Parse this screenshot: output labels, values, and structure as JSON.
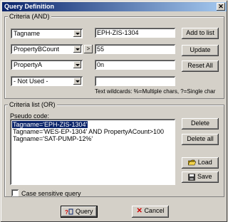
{
  "window": {
    "title": "Query Definition",
    "close_glyph": "✕"
  },
  "criteria_and": {
    "label": "Criteria (AND)",
    "rows": [
      {
        "field": "Tagname",
        "value": "EPH-ZIS-1304"
      },
      {
        "field": "PropertyBCount",
        "operator": ">",
        "value": "55"
      },
      {
        "field": "PropertyA",
        "value": "0n"
      },
      {
        "field": "- Not Used -",
        "value": ""
      }
    ],
    "buttons": {
      "add_to_list": "Add to list",
      "update": "Update",
      "reset_all": "Reset All"
    },
    "wildcard_hint": "Text wildcards: %=Multiple chars, ?=Single char"
  },
  "criteria_or": {
    "label": "Criteria list (OR)",
    "pseudo_label": "Pseudo code:",
    "items": [
      "Tagname='EPH-ZIS-1304'",
      "Tagname='WES-EP-1304' AND PropertyACount>100",
      "Tagname='SAT-PUMP-12%'"
    ],
    "selected_index": 0,
    "buttons": {
      "delete": "Delete",
      "delete_all": "Delete all",
      "load": "Load",
      "save": "Save"
    },
    "case_sensitive_label": "Case sensitive query",
    "case_sensitive_checked": false
  },
  "footer": {
    "query": "Query",
    "cancel": "Cancel"
  },
  "colors": {
    "title_start": "#0a246a",
    "title_end": "#a6caf0",
    "face": "#d4d0c8",
    "selection": "#0a246a",
    "cancel_x": "#cc0000"
  }
}
